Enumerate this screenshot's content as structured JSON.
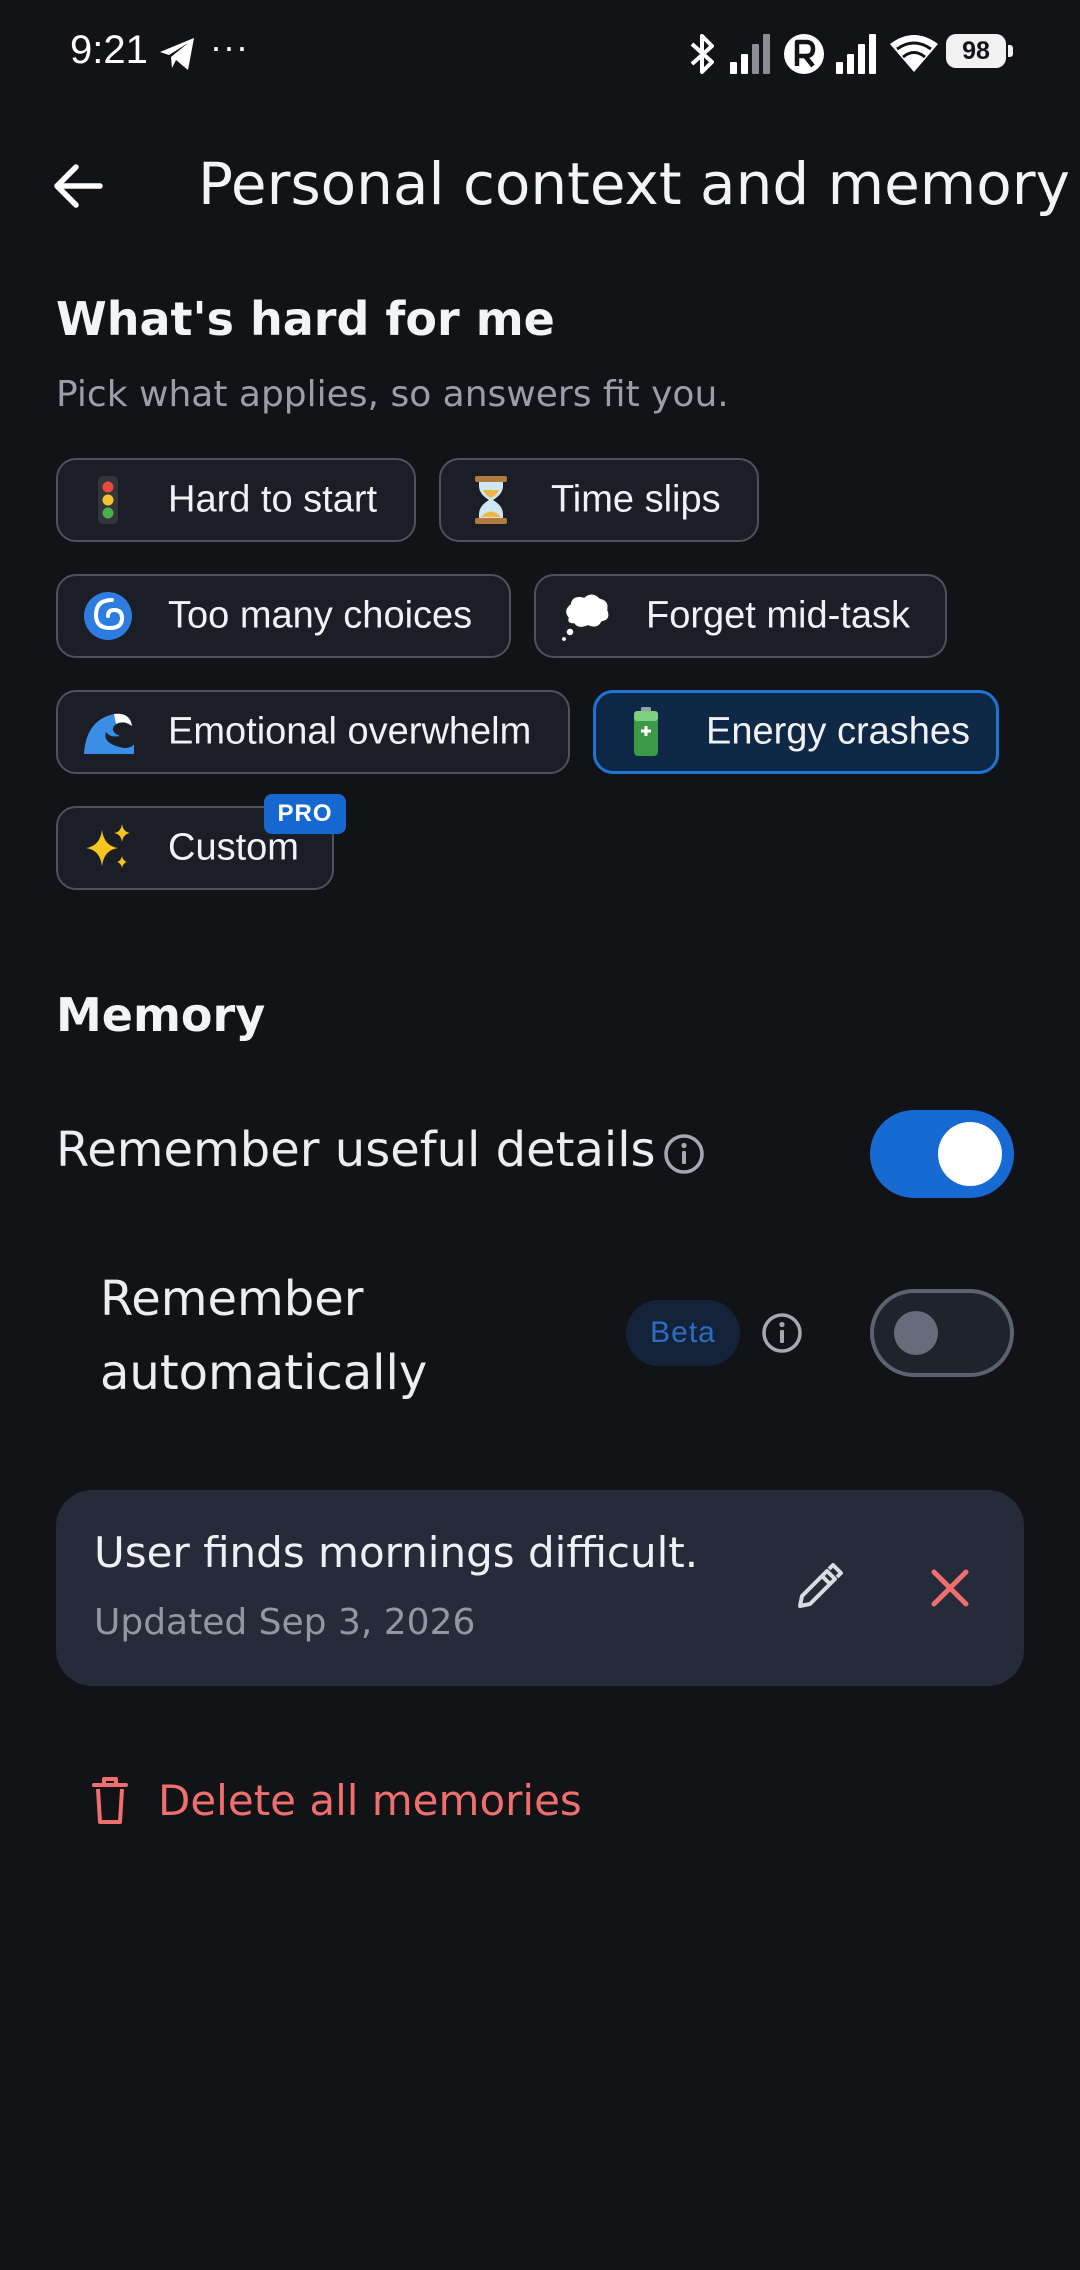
{
  "status_bar": {
    "time": "9:21",
    "overflow": "···",
    "battery": "98",
    "icons": [
      "telegram-icon",
      "bluetooth-icon",
      "signal-icon",
      "roaming-r-icon",
      "signal-icon",
      "wifi-icon",
      "battery-icon"
    ]
  },
  "header": {
    "title": "Personal context and memory",
    "back_icon": "arrow-left-icon"
  },
  "struggles": {
    "title": "What's hard for me",
    "subtitle": "Pick what applies, so answers fit you.",
    "chips": [
      {
        "emoji": "🚦",
        "icon": "traffic-light-icon",
        "label": "Hard to start",
        "selected": false
      },
      {
        "emoji": "⏳",
        "icon": "hourglass-icon",
        "label": "Time slips",
        "selected": false
      },
      {
        "emoji": "🌀",
        "icon": "cyclone-icon",
        "label": "Too many choices",
        "selected": false
      },
      {
        "emoji": "💭",
        "icon": "thought-bubble-icon",
        "label": "Forget mid-task",
        "selected": false
      },
      {
        "emoji": "🌊",
        "icon": "wave-icon",
        "label": "Emotional overwhelm",
        "selected": false
      },
      {
        "emoji": "🔋",
        "icon": "battery-icon",
        "label": "Energy crashes",
        "selected": true
      },
      {
        "emoji": "✨",
        "icon": "sparkles-icon",
        "label": "Custom",
        "selected": false,
        "badge": "PRO"
      }
    ]
  },
  "memory": {
    "title": "Memory",
    "remember_details": {
      "label": "Remember useful details",
      "enabled": true
    },
    "remember_auto": {
      "label": "Remember automatically",
      "badge": "Beta",
      "enabled": false
    },
    "items": [
      {
        "text": "User finds mornings difficult.",
        "updated": "Updated Sep 3, 2026"
      }
    ],
    "delete_all_label": "Delete all memories"
  },
  "colors": {
    "background": "#121317",
    "accent": "#176ad1",
    "danger": "#ef6e6e",
    "card": "#262b39"
  }
}
